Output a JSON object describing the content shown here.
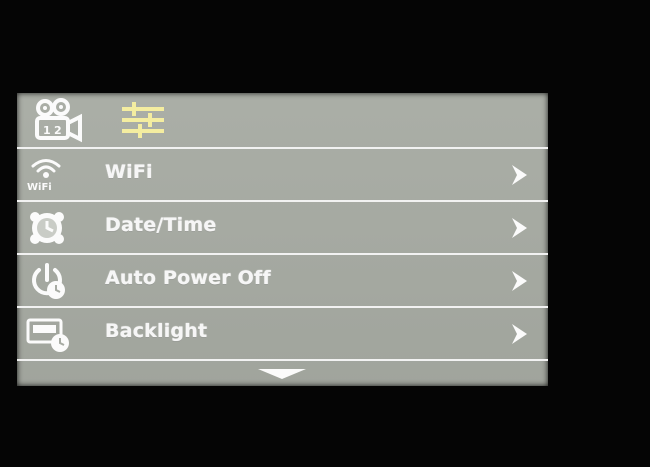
{
  "header": {
    "tabs": [
      {
        "icon": "video-camera-icon",
        "selected": false
      },
      {
        "icon": "settings-sliders-icon",
        "selected": true
      }
    ]
  },
  "menu": {
    "items": [
      {
        "label": "WiFi",
        "icon": "wifi-icon"
      },
      {
        "label": "Date/Time",
        "icon": "clock-icon"
      },
      {
        "label": "Auto Power Off",
        "icon": "auto-power-off-icon"
      },
      {
        "label": "Backlight",
        "icon": "backlight-icon"
      }
    ]
  },
  "colors": {
    "screen": "#a7aba3",
    "text": "#f6f6f6",
    "selected_tab": "#f4eda0",
    "divider": "#f2f2f2"
  },
  "icons": {
    "item_arrow": "chevron-right-icon",
    "scroll": "scroll-down-icon"
  }
}
